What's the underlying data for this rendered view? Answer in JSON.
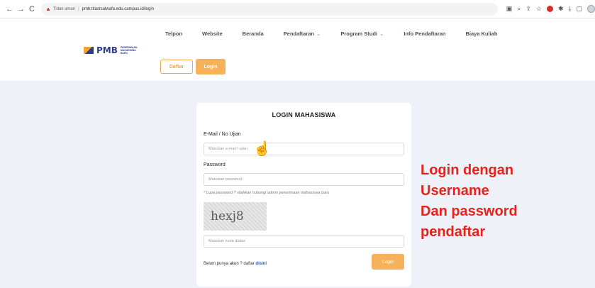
{
  "browser": {
    "nav": [
      "←",
      "→",
      "C"
    ],
    "security": "Tidak aman",
    "url": "pmb.titastsalwafa.edu.campus.id/login",
    "ext_icons": [
      "page-icon",
      "zoom-icon",
      "share-icon",
      "star-icon",
      "opera-icon",
      "puzzle-icon",
      "download-icon",
      "window-icon",
      "profile-icon"
    ]
  },
  "header": {
    "logo_text": "PMB",
    "logo_caption": "PENERIMAAN MAHASISWA BARU",
    "menu": [
      {
        "label": "Telpon",
        "dropdown": false
      },
      {
        "label": "Website",
        "dropdown": false
      },
      {
        "label": "Beranda",
        "dropdown": false
      },
      {
        "label": "Pendaftaran",
        "dropdown": true
      },
      {
        "label": "Program Studi",
        "dropdown": true
      },
      {
        "label": "Info Pendaftaran",
        "dropdown": false
      },
      {
        "label": "Biaya Kuliah",
        "dropdown": false
      }
    ],
    "daftar_label": "Daftar",
    "login_label": "Login"
  },
  "login": {
    "title": "LOGIN MAHASISWA",
    "email_label": "E-Mail / No Ujian",
    "email_placeholder": "Masukan e-mail / ujian",
    "password_label": "Password",
    "password_placeholder": "Masukan password",
    "hint": "* Lupa password ? silahkan hubungi admin penerimaan mahasiswa baru",
    "captcha_text": "hexj8",
    "captcha_placeholder": "Masukan kode diatas",
    "register_prefix": "Belum punya",
    "register_account": "akun",
    "register_middle": "? daftar",
    "register_link": "disini",
    "submit_label": "Login"
  },
  "annotation": {
    "lines": [
      "Login dengan",
      "Username",
      "Dan password",
      "pendaftar"
    ]
  },
  "colors": {
    "accent": "#f5b25a",
    "annotation": "#e8221b",
    "background": "#eef2f8"
  }
}
